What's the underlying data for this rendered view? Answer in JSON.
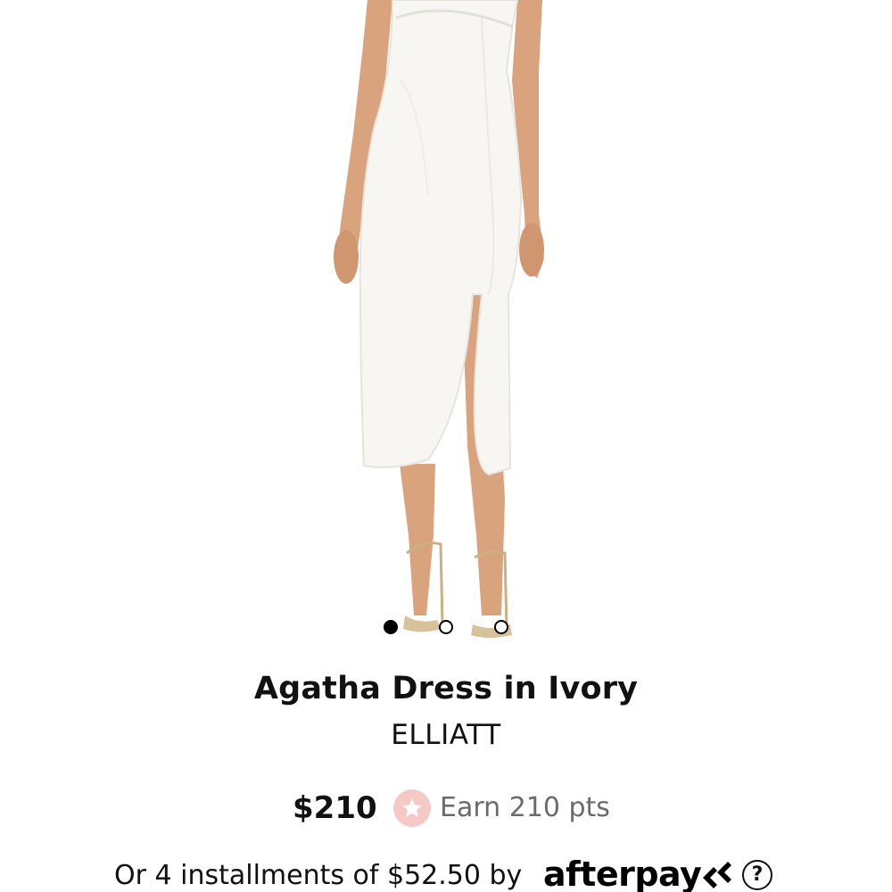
{
  "product": {
    "title": "Agatha Dress in Ivory",
    "brand": "ELLIATT",
    "price": "$210",
    "points_text": "Earn 210 pts",
    "installments_text": "Or 4 installments of $52.50 by",
    "afterpay_logo": "afterpay",
    "help_glyph": "?"
  },
  "carousel": {
    "dots": [
      {
        "state": "active"
      },
      {
        "state": "inactive"
      },
      {
        "state": "inactive"
      }
    ]
  },
  "icons": {
    "points": "star-icon",
    "afterpay": "afterpay-arrows-icon",
    "help": "question-icon"
  },
  "colors": {
    "points_badge": "#f6c9c6",
    "muted_text": "#6b6b6b",
    "skin": "#d9a37d",
    "dress": "#f7f6f2"
  }
}
